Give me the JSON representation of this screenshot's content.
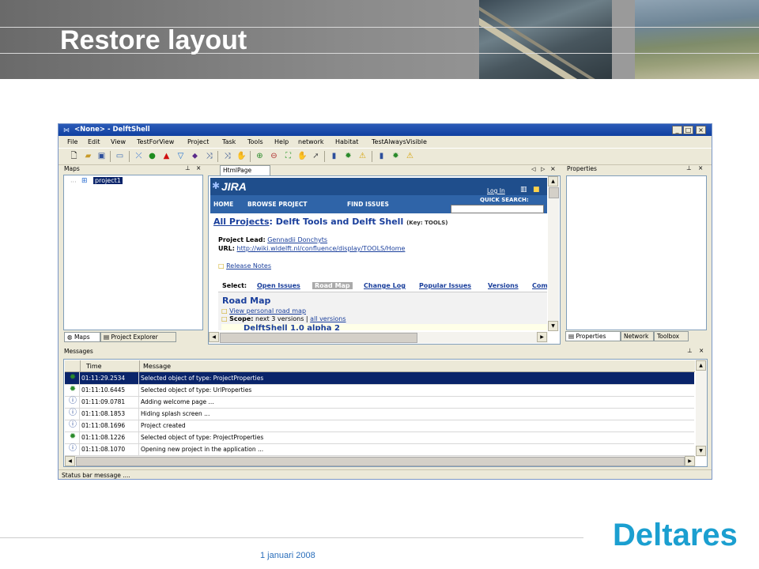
{
  "slide": {
    "title": "Restore layout",
    "date": "1 januari 2008",
    "logo": "Deltares"
  },
  "window": {
    "title": "<None> - DelftShell",
    "buttons": [
      "_",
      "□",
      "×"
    ]
  },
  "menu": [
    "File",
    "Edit",
    "View",
    "TestForView",
    "Project",
    "Task",
    "Tools",
    "Help",
    "network",
    "Habitat",
    "TestAlwaysVisible"
  ],
  "panes": {
    "maps": {
      "title": "Maps",
      "pin": "⊥",
      "close": "×",
      "tree_item": "project1",
      "tabs": [
        "Maps",
        "Project Explorer"
      ]
    },
    "document": {
      "tab": "HtmlPage",
      "controls": [
        "◁",
        "▷",
        "×"
      ]
    },
    "properties": {
      "title": "Properties",
      "tabs": [
        "Properties",
        "Network",
        "Toolbox"
      ]
    },
    "messages": {
      "title": "Messages",
      "columns": [
        "Time",
        "Message"
      ],
      "rows": [
        {
          "icon": "gear",
          "time": "01:11:29.2534",
          "message": "Selected object of type: ProjectProperties",
          "selected": true
        },
        {
          "icon": "gear",
          "time": "01:11:10.6445",
          "message": "Selected object of type: UrlProperties",
          "selected": false
        },
        {
          "icon": "info",
          "time": "01:11:09.0781",
          "message": "Adding welcome page ...",
          "selected": false
        },
        {
          "icon": "info",
          "time": "01:11:08.1853",
          "message": "Hiding splash screen ...",
          "selected": false
        },
        {
          "icon": "info",
          "time": "01:11:08.1696",
          "message": "Project created",
          "selected": false
        },
        {
          "icon": "gear",
          "time": "01:11:08.1226",
          "message": "Selected object of type: ProjectProperties",
          "selected": false
        },
        {
          "icon": "info",
          "time": "01:11:08.1070",
          "message": "Opening new project in the application ...",
          "selected": false
        }
      ]
    }
  },
  "jira": {
    "logo": "JIRA",
    "login": "Log In",
    "nav": [
      "HOME",
      "BROWSE PROJECT",
      "FIND ISSUES"
    ],
    "quick_search": "QUICK SEARCH:",
    "heading_link": "All Projects",
    "heading_rest": ": Delft Tools and Delft Shell",
    "heading_key": "(Key: TOOLS)",
    "lead_label": "Project Lead:",
    "lead_name": "Gennadii Donchyts",
    "url_label": "URL:",
    "url": "http://wiki.wldelft.nl/confluence/display/TOOLS/Home",
    "release_notes": "Release Notes",
    "select_label": "Select:",
    "select_tabs": [
      "Open Issues",
      "Road Map",
      "Change Log",
      "Popular Issues",
      "Versions",
      "Com"
    ],
    "roadmap_title": "Road Map",
    "view_personal": "View personal road map",
    "scope_label": "Scope:",
    "scope_text": "next 3 versions |",
    "all_versions": "all versions",
    "version_title": "DelftShell 1.0 alpha 2"
  },
  "status_bar": "Status bar message ....",
  "colors": {
    "titlebar": "#1040a0",
    "selection": "#0a246a",
    "jira_header": "#1f4e8c",
    "logo": "#1b9fd0",
    "date": "#2a6ebb"
  }
}
